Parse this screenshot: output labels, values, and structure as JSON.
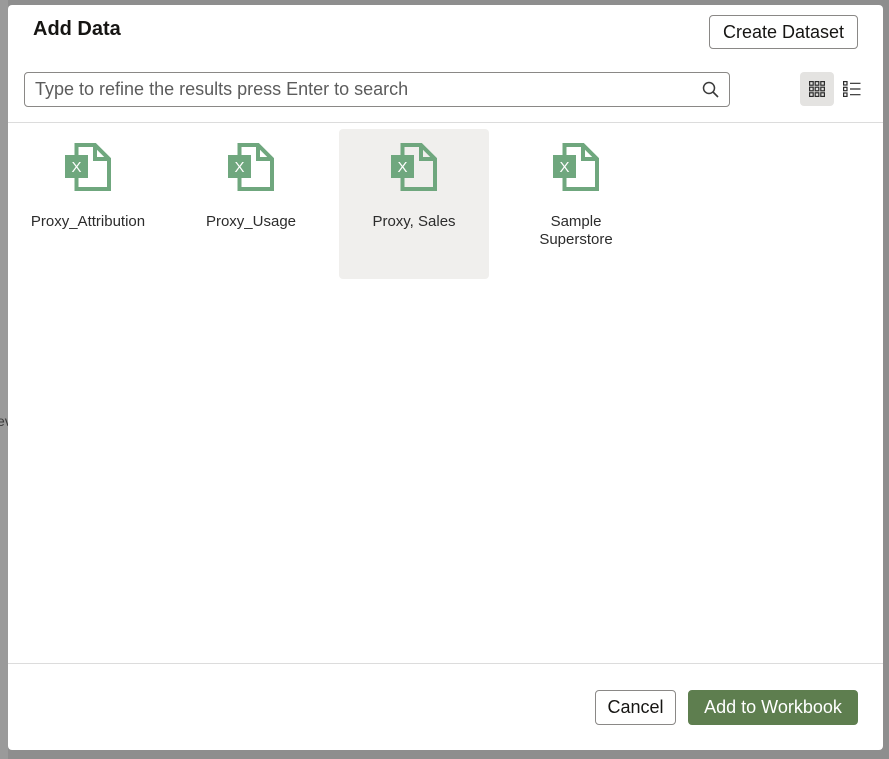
{
  "backdrop": {
    "text": "ev"
  },
  "dialog": {
    "title": "Add Data",
    "create_dataset_label": "Create Dataset",
    "search": {
      "placeholder": "Type to refine the results press Enter to search",
      "value": ""
    },
    "view_modes": [
      {
        "name": "grid",
        "icon": "grid-icon",
        "selected": true
      },
      {
        "name": "list",
        "icon": "list-icon",
        "selected": false
      }
    ],
    "items": [
      {
        "label": "Proxy_Attribution",
        "icon": "excel-file-icon",
        "selected": false
      },
      {
        "label": "Proxy_Usage",
        "icon": "excel-file-icon",
        "selected": false
      },
      {
        "label": "Proxy, Sales",
        "icon": "excel-file-icon",
        "selected": true
      },
      {
        "label": "Sample Superstore",
        "icon": "excel-file-icon",
        "selected": false
      }
    ],
    "cancel_label": "Cancel",
    "add_label": "Add to Workbook"
  },
  "colors": {
    "primary": "#5e7e4f",
    "excel_icon": "#6fa77e",
    "selected_tile": "#f0efed"
  }
}
